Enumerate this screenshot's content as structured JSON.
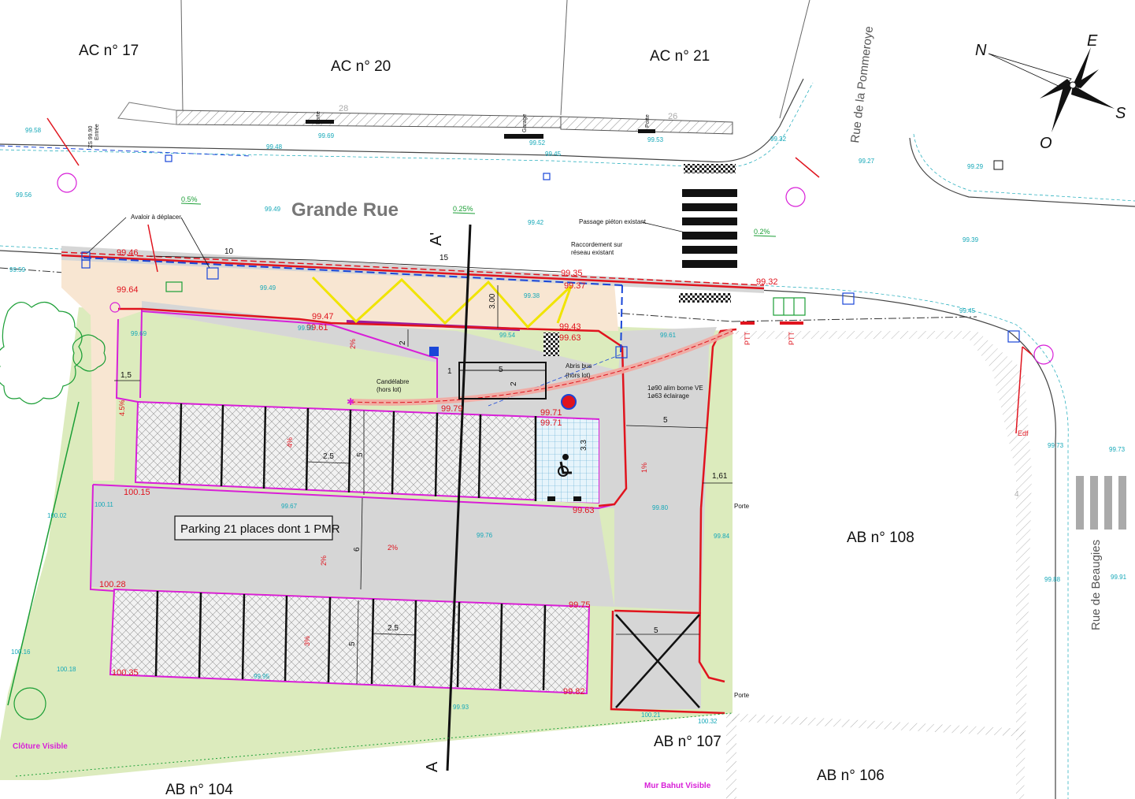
{
  "parcels": {
    "ac17": "AC n° 17",
    "ac20": "AC n° 20",
    "ac21": "AC n° 21",
    "ab108": "AB n° 108",
    "ab107": "AB n° 107",
    "ab106": "AB n° 106",
    "ab104": "AB n° 104"
  },
  "streets": {
    "grande_rue": "Grande Rue",
    "pommeroye": "Rue de la Pommeroye",
    "beaugies": "Rue de Beaugies"
  },
  "compass": {
    "n": "N",
    "e": "E",
    "s": "S",
    "o": "O"
  },
  "section": {
    "a1": "A'",
    "a2": "A"
  },
  "parking_label": "Parking 21 places dont 1 PMR",
  "notes": {
    "avaloir": "Avaloir à déplacer",
    "passage": "Passage piéton existant",
    "raccord1": "Raccordement sur",
    "raccord2": "réseau existant",
    "candelabre1": "Candélabre",
    "candelabre2": "(hors lot)",
    "abris1": "Abris bus",
    "abris2": "(hors lot)",
    "alim1": "1ø90 alim borne VE",
    "alim2": "1ø63 éclairage",
    "porte_top1": "Porte",
    "porte_top2": "Porte",
    "garage": "Garage",
    "porte_right": "Porte",
    "porte_bottom": "Porte",
    "cloture": "Clôture Visible",
    "mur": "Mur Bahut Visible",
    "edf": "Edf",
    "ptt1": "PTT",
    "ptt2": "PTT",
    "entree": "Entrée",
    "n28": "28",
    "n26": "26",
    "n4": "4"
  },
  "dimensions": {
    "d10": "10",
    "d15": "15",
    "d3": "3.00",
    "d2": "2",
    "d1": "1",
    "d5a": "5",
    "d2b": "2",
    "d15b": "1,5",
    "d25a": "2.5",
    "d5b": "5",
    "d33": "3.3",
    "d5c": "5",
    "d161": "1,61",
    "d6": "6",
    "d25b": "2.5",
    "d5d": "5",
    "d5e": "5"
  },
  "slopes": {
    "s05": "0.5%",
    "s025": "0.25%",
    "s02": "0.2%",
    "s2a": "2%",
    "s45": "4.5%",
    "s4b": "4%",
    "s1": "1%",
    "s2b": "2%",
    "s2c": "2%",
    "s3": "3%"
  },
  "levels_red": {
    "l9946": "99.46",
    "l9964": "99.64",
    "l9961": "99.61",
    "l9947": "99.47",
    "l9935": "99.35",
    "l9937": "99.37",
    "l9943": "99.43",
    "l9963": "99.63",
    "l9932": "99.32",
    "l9979": "99.79",
    "l9971": "99.71",
    "l9971b": "99.71",
    "l10015": "100.15",
    "l9963b": "99.63",
    "l10028": "100.28",
    "l9975": "99.75",
    "l10035": "100.35",
    "l9982": "99.82"
  },
  "levels": {
    "t9958": "99.58",
    "t9948": "99.48",
    "t9969": "99.69",
    "t9952": "99.52",
    "t9945": "99.45",
    "t9953": "99.53",
    "t9932": "99.32",
    "t9927": "99.27",
    "t9929": "99.29",
    "t9956": "99.56",
    "t9949": "99.49",
    "t9942": "99.42",
    "t9939": "99.39",
    "t9959": "99.59",
    "t9949b": "99.49",
    "t9938": "99.38",
    "t9954": "99.54",
    "t9961": "99.61",
    "t9945b": "99.45",
    "t9959b": "99.59",
    "t9969b": "99.69",
    "t1011": "100.11",
    "t9967": "99.67",
    "t9976": "99.76",
    "t9980": "99.80",
    "t9984": "99.84",
    "t10002": "100.02",
    "t9988": "99.88",
    "t9991": "99.91",
    "t9973": "99.73",
    "t9973b": "99.73",
    "t1016": "100.16",
    "t10018": "100.18",
    "t9993": "99.93",
    "t10021": "100.21",
    "t10032": "100.32",
    "t9995": "99.95",
    "zs": "ZS 99.90"
  },
  "colors": {
    "curb": "#e0141e",
    "parking_edge": "#d81fd8",
    "paving": "#d9d9d9",
    "sidewalk": "#f8e6d2",
    "green": "#dcebbd",
    "marking": "#f0e400",
    "network": "#1946d8",
    "level": "#15a8b8"
  }
}
